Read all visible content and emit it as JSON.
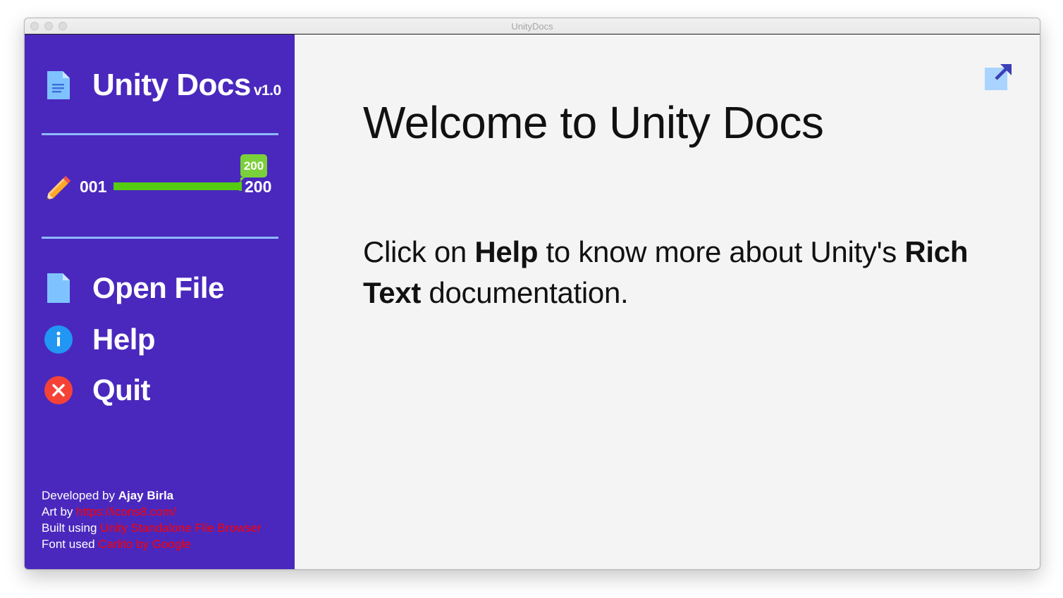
{
  "window": {
    "title": "UnityDocs"
  },
  "sidebar": {
    "app_name": "Unity Docs",
    "version": "v1.0",
    "font_size_slider": {
      "min_label": "001",
      "max_label": "200",
      "value_label": "200",
      "value": 200,
      "min": 1,
      "max": 200
    },
    "menu": [
      {
        "label": "Open File",
        "icon": "file-icon"
      },
      {
        "label": "Help",
        "icon": "info-icon"
      },
      {
        "label": "Quit",
        "icon": "close-icon"
      }
    ],
    "credits": {
      "developed_prefix": "Developed by",
      "developer": "Ajay Birla",
      "art_prefix": "Art by",
      "art_link": "https://icons8.com/",
      "built_prefix": "Built using",
      "built_link": "Unity Standalone File Browser",
      "font_prefix": "Font used",
      "font_link": "Carlito by Google"
    }
  },
  "main": {
    "title": "Welcome to Unity Docs",
    "body": {
      "part1": "Click on ",
      "bold1": "Help",
      "part2": " to know more about Unity's ",
      "bold2": "Rich Text",
      "part3": " documentation."
    }
  },
  "colors": {
    "sidebar_bg": "#4a28bd",
    "divider": "#8fb8ff",
    "slider_fill": "#55cc11",
    "link": "#ff0000",
    "main_bg": "#f4f4f4"
  }
}
